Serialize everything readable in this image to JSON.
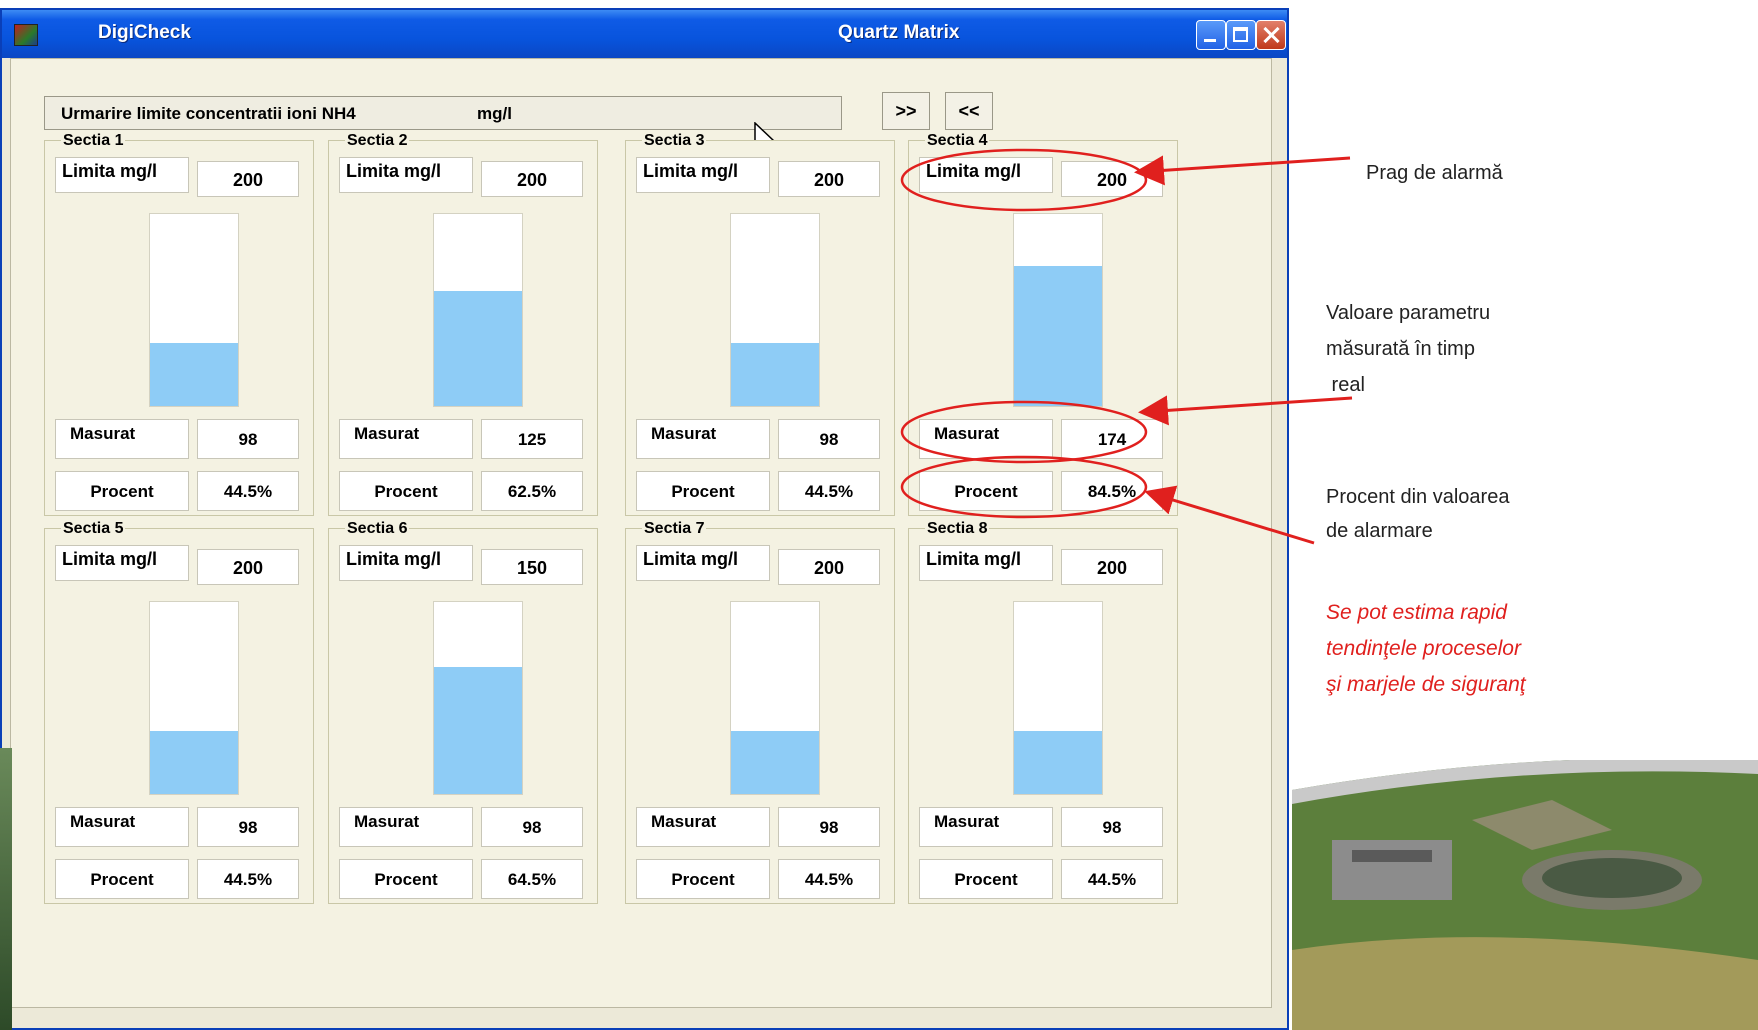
{
  "window": {
    "app_name": "DigiCheck",
    "title": "Quartz Matrix"
  },
  "header": {
    "title": "Urmarire limite concentratii ioni NH4",
    "unit": "mg/l",
    "next_label": ">>",
    "prev_label": "<<"
  },
  "labels": {
    "limita": "Limita mg/l",
    "masurat": "Masurat",
    "procent": "Procent"
  },
  "sections": [
    {
      "name": "Sectia 1",
      "limita": "200",
      "masurat": "98",
      "procent": "44.5%",
      "fill": 0.33
    },
    {
      "name": "Sectia 2",
      "limita": "200",
      "masurat": "125",
      "procent": "62.5%",
      "fill": 0.6
    },
    {
      "name": "Sectia 3",
      "limita": "200",
      "masurat": "98",
      "procent": "44.5%",
      "fill": 0.33
    },
    {
      "name": "Sectia 4",
      "limita": "200",
      "masurat": "174",
      "procent": "84.5%",
      "fill": 0.73
    },
    {
      "name": "Sectia 5",
      "limita": "200",
      "masurat": "98",
      "procent": "44.5%",
      "fill": 0.33
    },
    {
      "name": "Sectia 6",
      "limita": "150",
      "masurat": "98",
      "procent": "64.5%",
      "fill": 0.66
    },
    {
      "name": "Sectia 7",
      "limita": "200",
      "masurat": "98",
      "procent": "44.5%",
      "fill": 0.33
    },
    {
      "name": "Sectia 8",
      "limita": "200",
      "masurat": "98",
      "procent": "44.5%",
      "fill": 0.33
    }
  ],
  "annotations": {
    "prag": "Prag de alarmă",
    "valoare_1": "Valoare parametru",
    "valoare_2": "măsurată în timp",
    "valoare_3": " real",
    "procent_1": "Procent din valoarea",
    "procent_2": "de alarmare",
    "note_1": "Se pot estima rapid",
    "note_2": "tendinţele proceselor",
    "note_3": "şi marjele de siguranţ",
    "accent_color": "#E0201E"
  }
}
